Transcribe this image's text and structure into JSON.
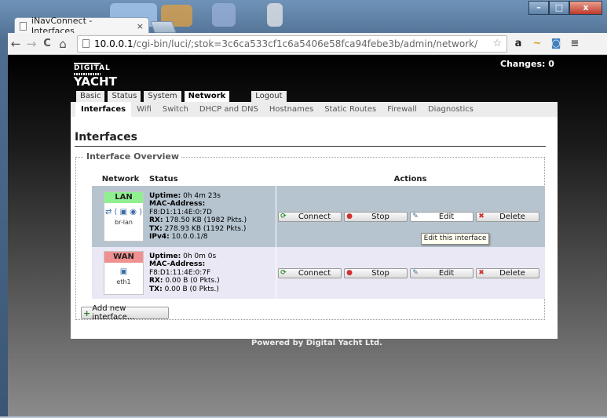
{
  "browser": {
    "tab_title": "iNavConnect - Interfaces",
    "tab_close": "×",
    "url_host": "10.0.0.1",
    "url_path": "/cgi-bin/luci/;stok=3c6ca533cf1c6a5406e58fca94febe3b/admin/network/",
    "star": "☆",
    "nav": {
      "back": "←",
      "forward": "→",
      "reload": "C",
      "home": "⌂"
    },
    "extensions": [
      "a",
      "~",
      "◙",
      "≡"
    ],
    "window_buttons": {
      "minimize": "–",
      "maximize": "□",
      "close": "x"
    }
  },
  "header": {
    "logo_line1": "DIGITAL",
    "logo_line2": "YACHT",
    "changes": "Changes: 0"
  },
  "topmenu": [
    {
      "label": "Basic",
      "active": false
    },
    {
      "label": "Status",
      "active": false
    },
    {
      "label": "System",
      "active": false
    },
    {
      "label": "Network",
      "active": true
    },
    {
      "label": "Logout",
      "active": false
    }
  ],
  "submenu": [
    {
      "label": "Interfaces",
      "active": true
    },
    {
      "label": "Wifi",
      "active": false
    },
    {
      "label": "Switch",
      "active": false
    },
    {
      "label": "DHCP and DNS",
      "active": false
    },
    {
      "label": "Hostnames",
      "active": false
    },
    {
      "label": "Static Routes",
      "active": false
    },
    {
      "label": "Firewall",
      "active": false
    },
    {
      "label": "Diagnostics",
      "active": false
    }
  ],
  "main": {
    "title": "Interfaces",
    "legend": "Interface Overview",
    "columns": {
      "network": "Network",
      "status": "Status",
      "actions": "Actions"
    },
    "interfaces": [
      {
        "name": "LAN",
        "color": "#90f090",
        "icons": "⇄ ( ▣ ◉ )",
        "device": "br-lan",
        "uptime_label": "Uptime:",
        "uptime": "0h 4m 23s",
        "mac_label": "MAC-Address:",
        "mac": "F8:D1:11:4E:0:7D",
        "rx_label": "RX:",
        "rx": "178.50 KB (1982 Pkts.)",
        "tx_label": "TX:",
        "tx": "278.93 KB (1192 Pkts.)",
        "ipv4_label": "IPv4:",
        "ipv4": "10.0.0.1/8"
      },
      {
        "name": "WAN",
        "color": "#f09090",
        "icons": "▣",
        "device": "eth1",
        "uptime_label": "Uptime:",
        "uptime": "0h 0m 0s",
        "mac_label": "MAC-Address:",
        "mac": "F8:D1:11:4E:0:7F",
        "rx_label": "RX:",
        "rx": "0.00 B (0 Pkts.)",
        "tx_label": "TX:",
        "tx": "0.00 B (0 Pkts.)"
      }
    ],
    "actions": {
      "connect": "Connect",
      "stop": "Stop",
      "edit": "Edit",
      "delete": "Delete"
    },
    "tooltip": "Edit this interface",
    "add_button": "Add new interface..."
  },
  "footer": "Powered by Digital Yacht Ltd."
}
